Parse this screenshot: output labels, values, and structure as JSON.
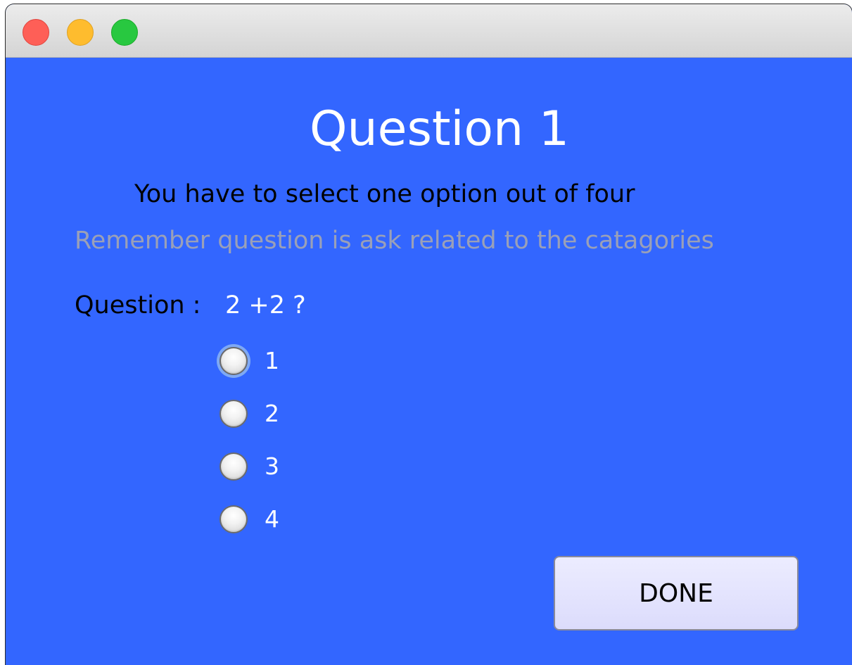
{
  "window": {
    "controls": [
      "close-button",
      "minimize-button",
      "zoom-button"
    ]
  },
  "main": {
    "title": "Question 1",
    "instruction": "You have to select one option out of four",
    "reminder": "Remember question is ask related to the catagories",
    "question_label": "Question :",
    "question_text": "2 +2 ?",
    "options": [
      {
        "label": "1"
      },
      {
        "label": "2"
      },
      {
        "label": "3"
      },
      {
        "label": "4"
      }
    ],
    "done_label": "DONE"
  },
  "colors": {
    "background": "#3366ff",
    "title_text": "#ffffff",
    "reminder_text": "#9aa0b8",
    "button_bg": "#e2e2fd"
  }
}
